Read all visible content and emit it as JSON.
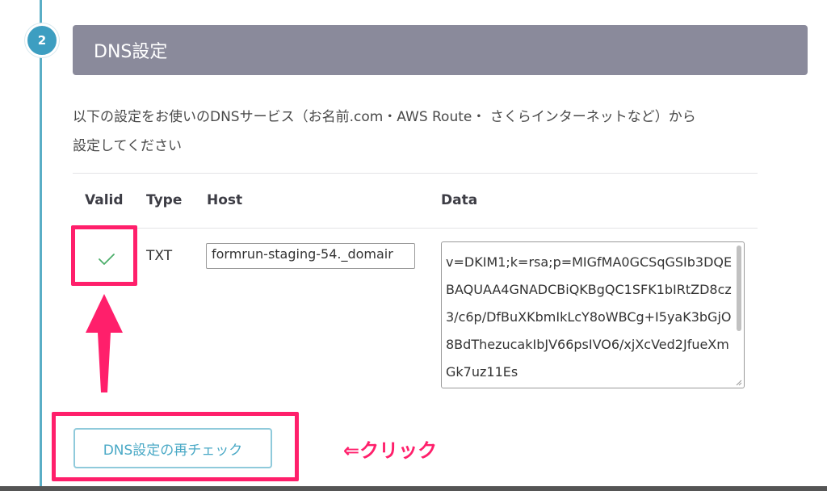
{
  "step": {
    "number": "2"
  },
  "section": {
    "title": "DNS設定",
    "description_line1": "以下の設定をお使いのDNSサービス（お名前.com・AWS Route・ さくらインターネットなど）から",
    "description_line2": "設定してください"
  },
  "table": {
    "headers": {
      "valid": "Valid",
      "type": "Type",
      "host": "Host",
      "data": "Data"
    },
    "row": {
      "valid": true,
      "type": "TXT",
      "host": "formrun-staging-54._domair",
      "data": "v=DKIM1;k=rsa;p=MIGfMA0GCSqGSIb3DQEBAQUAA4GNADCBiQKBgQC1SFK1bIRtZD8cz3/c6p/DfBuXKbmIkLcY8oWBCg+I5yaK3bGjO8BdThezucakIbJV66psIVO6/xjXcVed2JfueXmGk7uz11Es"
    }
  },
  "actions": {
    "recheck_label": "DNS設定の再チェック"
  },
  "annotation": {
    "text": "⇐クリック"
  },
  "colors": {
    "accent": "#3d9ec1",
    "header_bg": "#8a8a9b",
    "highlight": "#ff1f6b",
    "check": "#4cae6a"
  },
  "icons": {
    "valid": "checkmark-icon",
    "annotation_arrow": "arrow-up-icon"
  }
}
